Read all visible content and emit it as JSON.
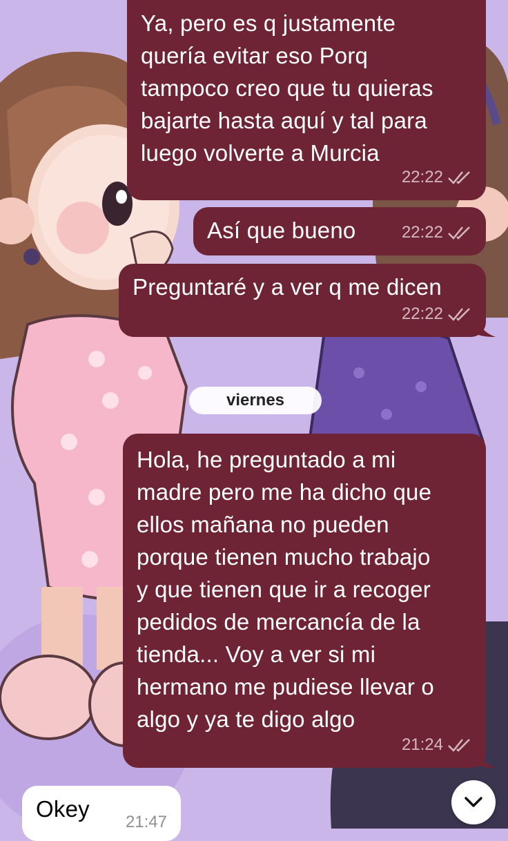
{
  "date_separator": "viernes",
  "messages": [
    {
      "direction": "outgoing",
      "lines": [
        "Ya, pero es q justamente",
        "quería evitar eso Porq",
        "tampoco creo que tu quieras",
        "bajarte hasta aquí y tal para",
        "luego volverte a Murcia"
      ],
      "time": "22:22",
      "status": "read"
    },
    {
      "direction": "outgoing",
      "lines": [
        "Así que bueno"
      ],
      "time": "22:22",
      "status": "read"
    },
    {
      "direction": "outgoing",
      "lines": [
        "Preguntaré y a ver q me dicen"
      ],
      "time": "22:22",
      "status": "read"
    },
    {
      "direction": "outgoing",
      "lines": [
        "Hola, he preguntado a mi",
        "madre pero me ha dicho que",
        "ellos mañana no pueden",
        "porque tienen mucho trabajo",
        "y que tienen que ir a recoger",
        "pedidos de mercancía de la",
        "tienda... Voy a ver si mi",
        "hermano me pudiese llevar o",
        "algo y ya te digo algo"
      ],
      "time": "21:24",
      "status": "read"
    },
    {
      "direction": "incoming",
      "lines": [
        "Okey"
      ],
      "time": "21:47"
    }
  ],
  "icons": {
    "read_status": "double-check-icon",
    "scroll_down": "chevron-down-icon"
  },
  "colors": {
    "outgoing_bubble": "#6e2435",
    "incoming_bubble": "#ffffff",
    "wallpaper": "#cbb6ea"
  }
}
